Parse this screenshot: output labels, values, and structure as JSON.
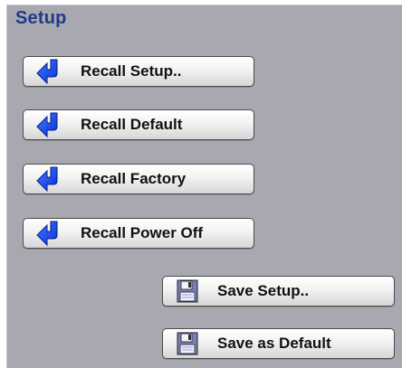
{
  "panel": {
    "title": "Setup",
    "title_color": "#21398a",
    "background": "#a8a8b0"
  },
  "buttons": {
    "recall_setup": {
      "label": "Recall Setup..",
      "icon": "blue-down-arrow-icon"
    },
    "recall_default": {
      "label": "Recall Default",
      "icon": "blue-down-arrow-icon"
    },
    "recall_factory": {
      "label": "Recall Factory",
      "icon": "blue-down-arrow-icon"
    },
    "recall_power_off": {
      "label": "Recall Power Off",
      "icon": "blue-down-arrow-icon"
    },
    "save_setup": {
      "label": "Save Setup..",
      "icon": "floppy-disk-icon"
    },
    "save_as_default": {
      "label": "Save as Default",
      "icon": "floppy-disk-icon"
    }
  }
}
